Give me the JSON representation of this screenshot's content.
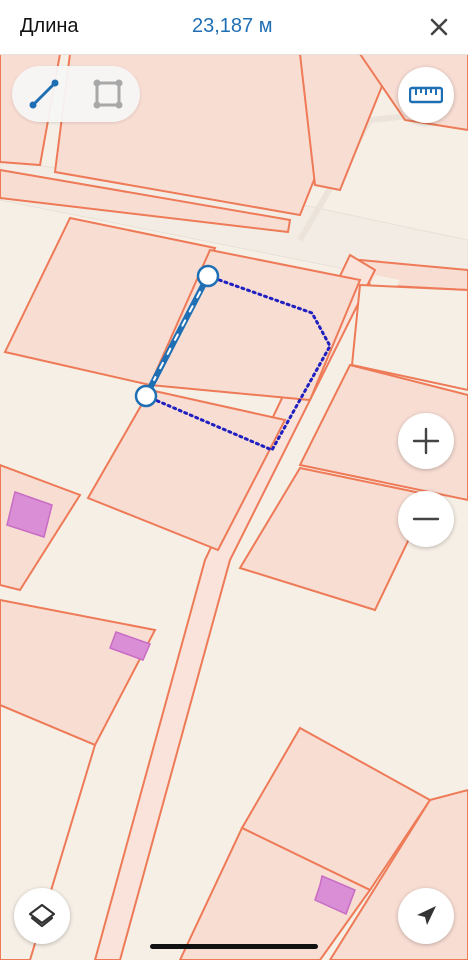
{
  "header": {
    "title": "Длина",
    "value": "23,187 м"
  },
  "icons": {
    "close": "close-icon",
    "line_tool": "line-tool-icon",
    "polygon_tool": "polygon-tool-icon",
    "ruler": "ruler-icon",
    "zoom_in": "plus-icon",
    "zoom_out": "minus-icon",
    "layers": "layers-icon",
    "location": "location-arrow-icon"
  },
  "colors": {
    "accent": "#1f6fb5",
    "parcel_fill": "#f8ddd3",
    "parcel_stroke": "#ee7a57",
    "building": "#d98ed6",
    "measure_dots": "#2020c0"
  }
}
